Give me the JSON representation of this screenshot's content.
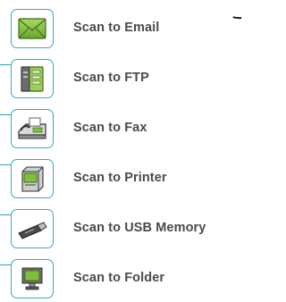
{
  "scan_menu": {
    "items": [
      {
        "label": "Scan to Email",
        "icon": "envelope-icon"
      },
      {
        "label": "Scan to FTP",
        "icon": "server-icon"
      },
      {
        "label": "Scan to Fax",
        "icon": "fax-machine-icon"
      },
      {
        "label": "Scan to Printer",
        "icon": "printer-icon"
      },
      {
        "label": "Scan to USB Memory",
        "icon": "usb-drive-icon"
      },
      {
        "label": "Scan to Folder",
        "icon": "computer-folder-icon"
      }
    ]
  },
  "colors": {
    "accent_border": "#3aa6c9",
    "label_text": "#4a4a4a",
    "icon_green": "#7fbf3a"
  }
}
